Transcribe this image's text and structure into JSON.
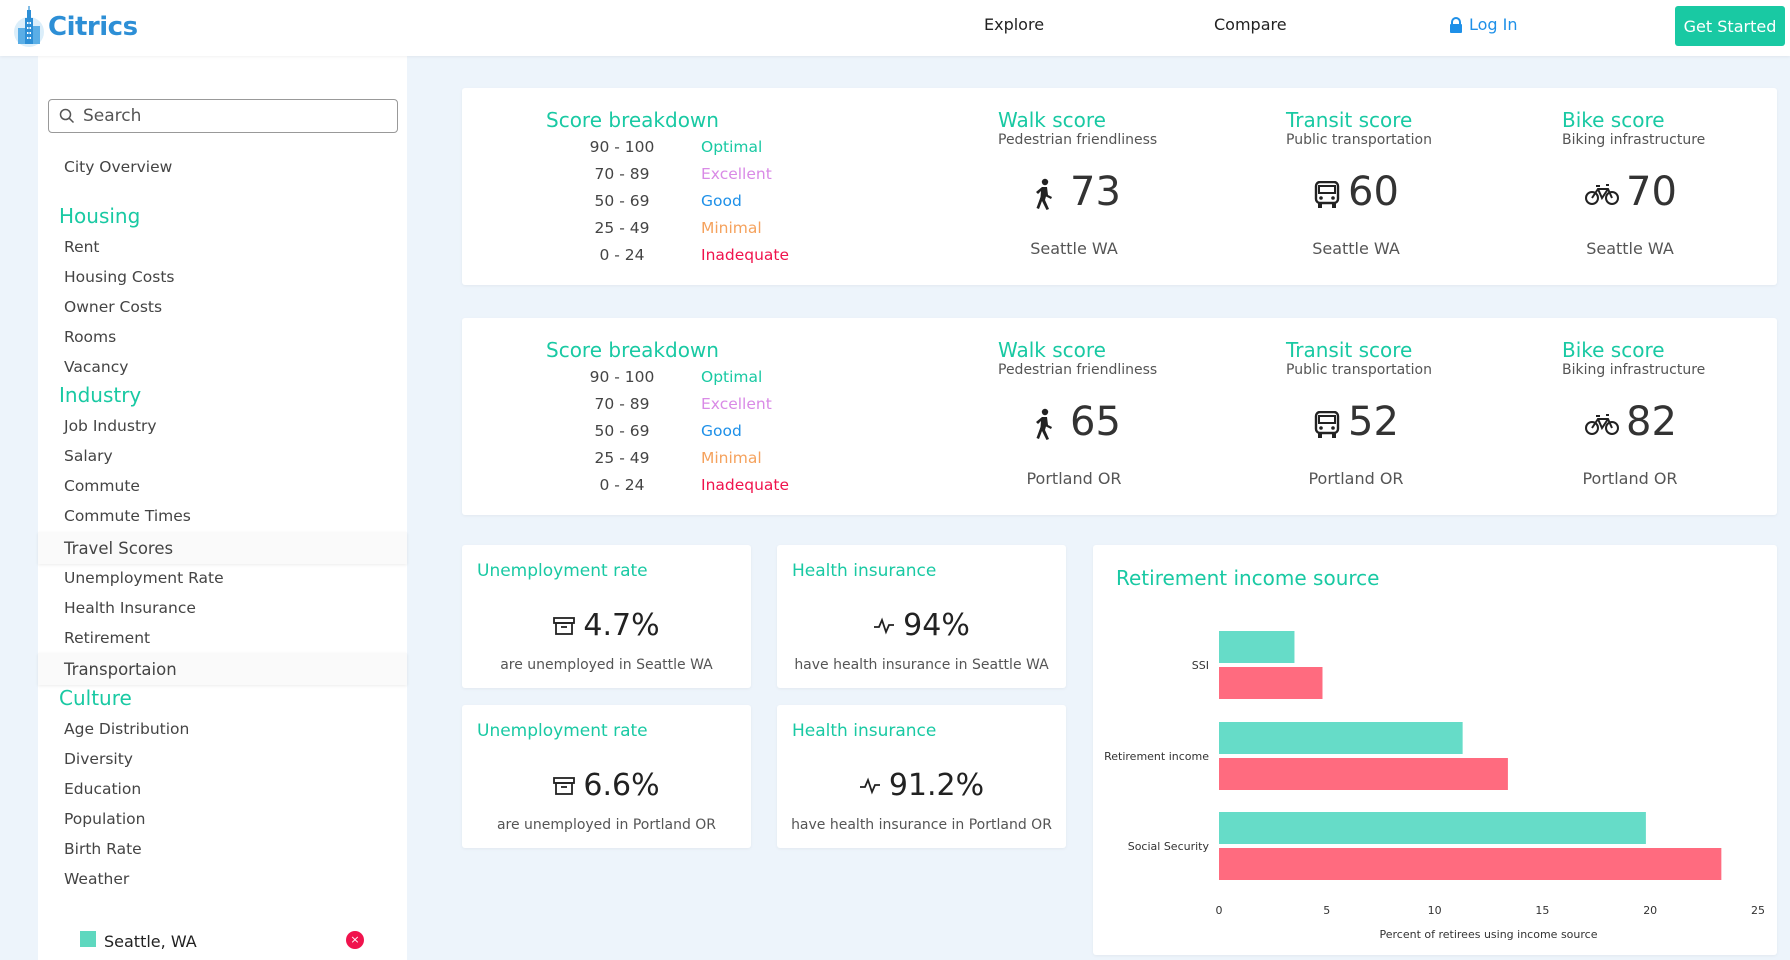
{
  "header": {
    "logo_text": "Citrics",
    "nav": [
      "Explore",
      "Compare"
    ],
    "login": "Log In",
    "get_started": "Get Started"
  },
  "sidebar": {
    "search_placeholder": "Search",
    "overview": "City Overview",
    "sections": [
      {
        "title": "Housing",
        "items": [
          "Rent",
          "Housing Costs",
          "Owner Costs",
          "Rooms",
          "Vacancy"
        ]
      },
      {
        "title": "Industry",
        "items": [
          "Job Industry",
          "Salary",
          "Commute",
          "Commute Times",
          "Travel Scores",
          "Unemployment Rate",
          "Health Insurance",
          "Retirement",
          "Transportaion"
        ]
      },
      {
        "title": "Culture",
        "items": [
          "Age Distribution",
          "Diversity",
          "Education",
          "Population",
          "Birth Rate",
          "Weather"
        ]
      }
    ],
    "city_legend": {
      "label": "Seattle, WA",
      "color": "#5ed8bf",
      "close": "×"
    }
  },
  "breakdown": {
    "title": "Score breakdown",
    "rows": [
      {
        "range": "90 - 100",
        "label": "Optimal",
        "color": "#19c9a3"
      },
      {
        "range": "70 - 89",
        "label": "Excellent",
        "color": "#d98ae6"
      },
      {
        "range": "50 - 69",
        "label": "Good",
        "color": "#1e90e8"
      },
      {
        "range": "25 - 49",
        "label": "Minimal",
        "color": "#f5a25d"
      },
      {
        "range": "0 - 24",
        "label": "Inadequate",
        "color": "#f0134d"
      }
    ]
  },
  "score_labels": {
    "walk_title": "Walk score",
    "walk_sub": "Pedestrian friendliness",
    "transit_title": "Transit score",
    "transit_sub": "Public transportation",
    "bike_title": "Bike score",
    "bike_sub": "Biking infrastructure"
  },
  "panels": [
    {
      "city": "Seattle WA",
      "walk": "73",
      "transit": "60",
      "bike": "70"
    },
    {
      "city": "Portland OR",
      "walk": "65",
      "transit": "52",
      "bike": "82"
    }
  ],
  "cards": {
    "unemployment_title": "Unemployment rate",
    "health_title": "Health insurance",
    "seattle_unemp": "4.7%",
    "seattle_unemp_desc": "are unemployed in Seattle WA",
    "seattle_health": "94%",
    "seattle_health_desc": "have health insurance in Seattle WA",
    "portland_unemp": "6.6%",
    "portland_unemp_desc": "are unemployed in Portland OR",
    "portland_health": "91.2%",
    "portland_health_desc": "have health insurance in Portland OR"
  },
  "chart_data": {
    "type": "bar",
    "orientation": "horizontal",
    "title": "Retirement income source",
    "xlabel": "Percent of retirees using income source",
    "ylabel": "",
    "categories": [
      "SSI",
      "Retirement income",
      "Social Security"
    ],
    "series": [
      {
        "values": [
          3.5,
          11.3,
          19.8
        ],
        "color": "#66dcc8"
      },
      {
        "values": [
          4.8,
          13.4,
          23.3
        ],
        "color": "#ff6b7f"
      }
    ],
    "xlim": [
      0,
      25
    ],
    "xticks": [
      0,
      5,
      10,
      15,
      20,
      25
    ],
    "grid": false,
    "legend": "none"
  }
}
